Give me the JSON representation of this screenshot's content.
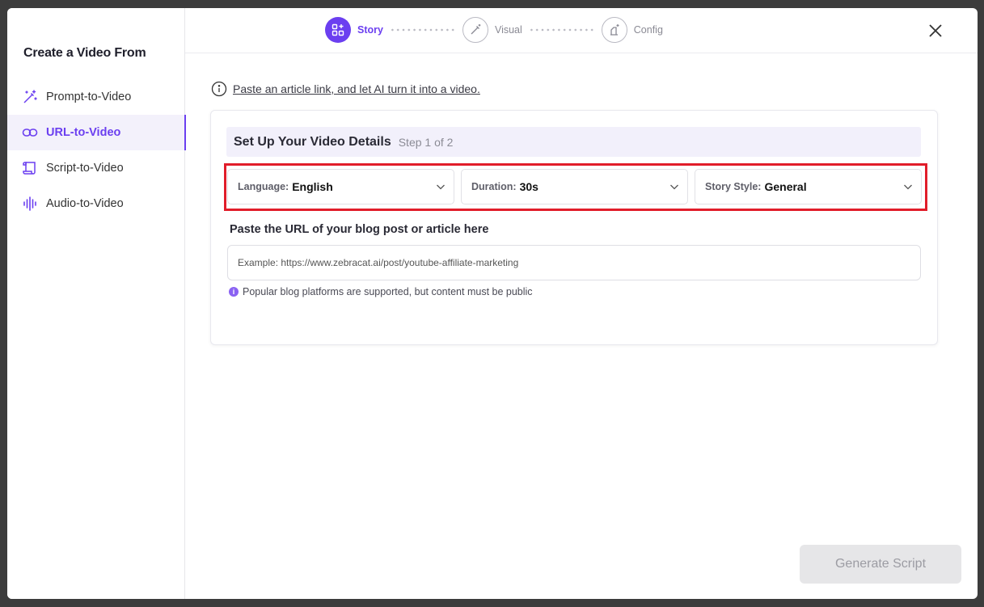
{
  "sidebar": {
    "title": "Create a Video From",
    "items": [
      {
        "label": "Prompt-to-Video",
        "icon": "magic-wand-icon"
      },
      {
        "label": "URL-to-Video",
        "icon": "link-icon",
        "active": true
      },
      {
        "label": "Script-to-Video",
        "icon": "scroll-icon"
      },
      {
        "label": "Audio-to-Video",
        "icon": "audio-wave-icon"
      }
    ]
  },
  "stepper": {
    "steps": [
      {
        "label": "Story",
        "active": true
      },
      {
        "label": "Visual",
        "active": false
      },
      {
        "label": "Config",
        "active": false
      }
    ]
  },
  "hint": {
    "text": "Paste an article link, and let AI turn it into a video."
  },
  "card": {
    "title": "Set Up Your Video Details",
    "step": "Step 1 of 2",
    "selects": [
      {
        "label": "Language:",
        "value": "English"
      },
      {
        "label": "Duration:",
        "value": "30s"
      },
      {
        "label": "Story Style:",
        "value": "General"
      }
    ],
    "url_label": "Paste the URL of your blog post or article here",
    "url_placeholder": "Example: https://www.zebracat.ai/post/youtube-affiliate-marketing",
    "url_value": "",
    "note": "Popular blog platforms are supported, but content must be public"
  },
  "footer": {
    "generate_label": "Generate Script"
  },
  "colors": {
    "accent": "#6b3ff0",
    "highlight": "#e11d2a",
    "disabled_bg": "#e6e6e8"
  }
}
